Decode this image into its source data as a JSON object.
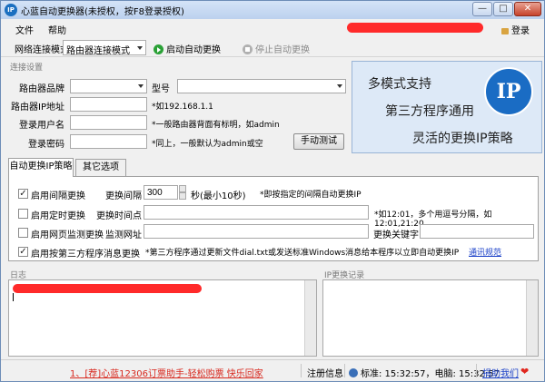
{
  "window": {
    "title": "心蓝自动更换器(未授权，按F8登录授权)",
    "minimize": "—",
    "maximize": "□",
    "close": "✕"
  },
  "menu": {
    "file": "文件",
    "help": "帮助",
    "login": "登录"
  },
  "toolbar": {
    "mode_label": "网络连接模式",
    "mode_value": "路由器连接模式",
    "start": "启动自动更换",
    "stop": "停止自动更换"
  },
  "connection": {
    "group_title": "连接设置",
    "brand_label": "路由器品牌",
    "model_label": "型号",
    "ip_label": "路由器IP地址",
    "ip_hint": "*如192.168.1.1",
    "user_label": "登录用户名",
    "user_hint": "*一般路由器背面有标明，如admin",
    "pwd_label": "登录密码",
    "pwd_hint": "*同上，一般默认为admin或空",
    "test_button": "手动测试"
  },
  "ad": {
    "line1": "多模式支持",
    "line2": "第三方程序通用",
    "line3": "灵活的更换IP策略",
    "logo": "IP"
  },
  "tabs": {
    "strategy": "自动更换IP策略",
    "other": "其它选项"
  },
  "strategy": {
    "interval_enable": "启用间隔更换",
    "interval_label": "更换间隔",
    "interval_value": "300",
    "interval_unit": "秒(最小10秒)",
    "interval_hint": "*即按指定的间隔自动更换IP",
    "timed_enable": "启用定时更换",
    "timed_label": "更换时间点",
    "timed_hint": "*如12:01，多个用逗号分隔，如12:01,21:20",
    "web_enable": "启用网页监测更换",
    "web_url_label": "监测网址",
    "web_kw_label": "更换关键字",
    "third_enable": "启用按第三方程序消息更换",
    "third_hint": "*第三方程序通过更新文件dial.txt或发送标准Windows消息给本程序以立即自动更换IP",
    "third_link": "通讯规范"
  },
  "log": {
    "title": "日志",
    "ip_title": "IP更换记录"
  },
  "status": {
    "ad": "1、[荐]心蓝12306订票助手-轻松购票 快乐回家",
    "reg": "注册信息",
    "time": "标准: 15:32:57，电脑: 15:32:57",
    "donate": "捐助我们"
  },
  "colors": {
    "title_gradient": "#c8dbf3",
    "accent_blue": "#1a6cc4",
    "ad_bg": "#dde9f7",
    "redaction": "#ff2a2a",
    "status_red": "#d8281e"
  }
}
